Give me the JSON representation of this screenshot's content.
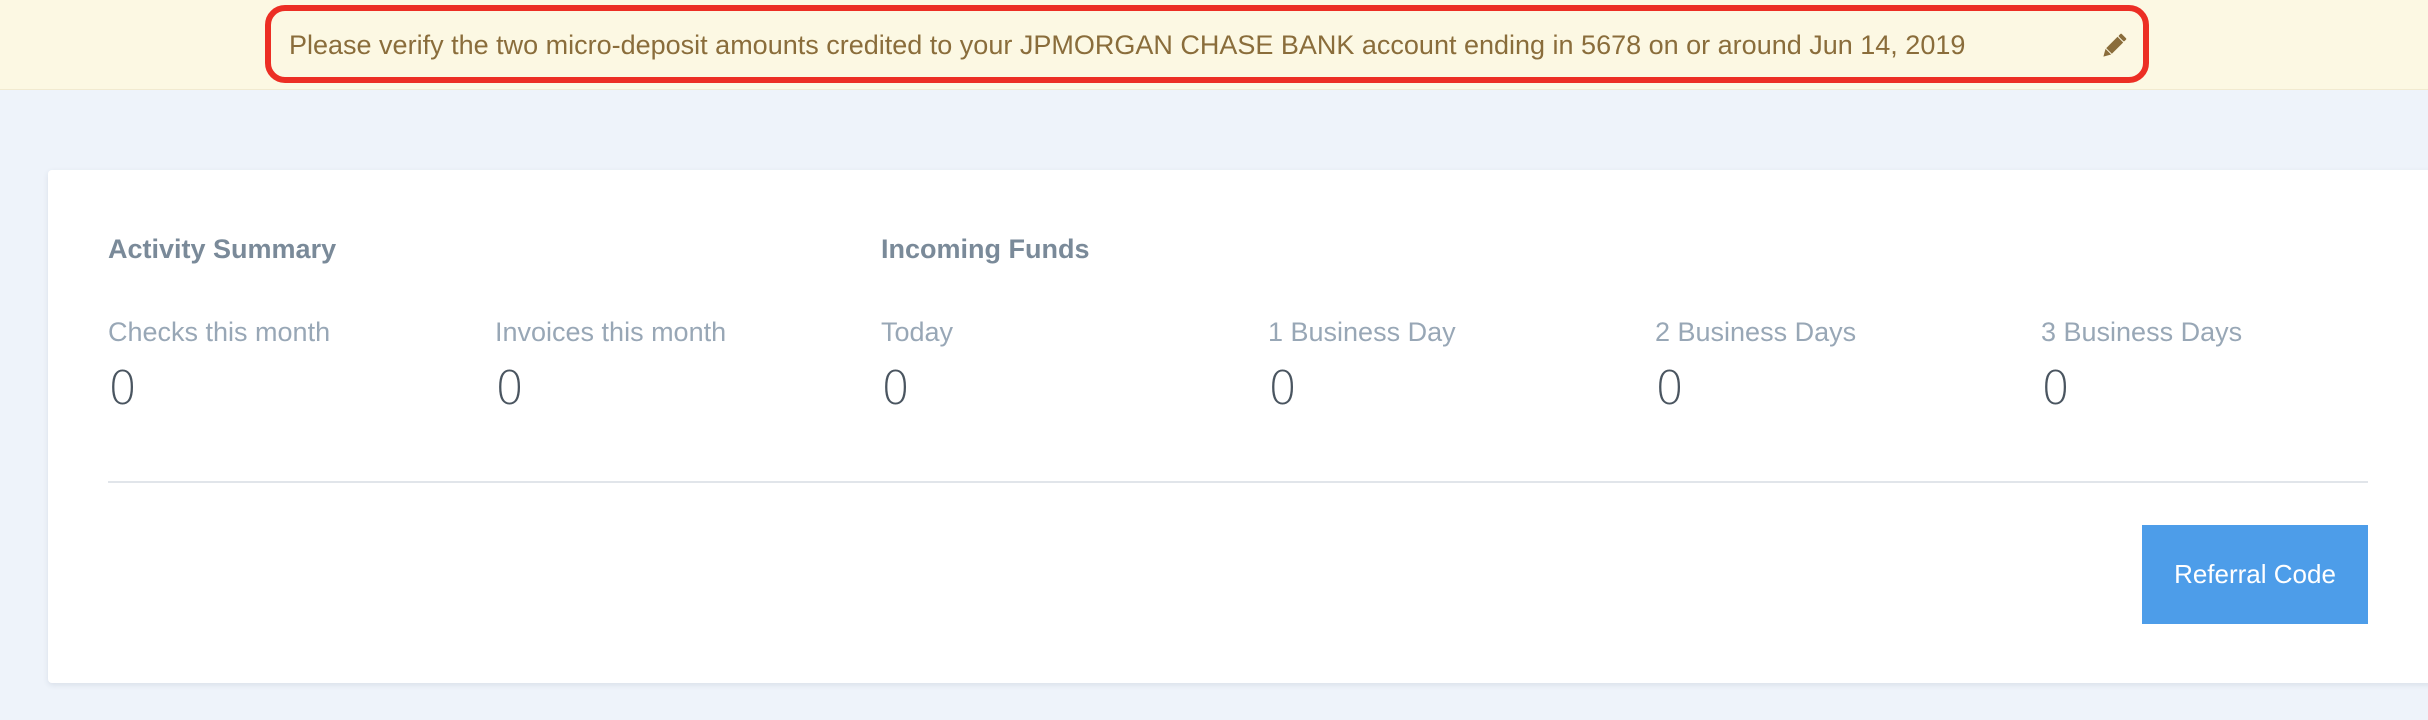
{
  "banner": {
    "message": "Please verify the two micro-deposit amounts credited to your JPMORGAN CHASE BANK account ending in 5678 on or around Jun 14, 2019",
    "edit_icon": "pencil-icon",
    "highlight_color": "#ec2e24"
  },
  "activity_summary": {
    "title": "Activity Summary",
    "stats": [
      {
        "label": "Checks this month",
        "value": "0"
      },
      {
        "label": "Invoices this month",
        "value": "0"
      }
    ]
  },
  "incoming_funds": {
    "title": "Incoming Funds",
    "stats": [
      {
        "label": "Today",
        "value": "0"
      },
      {
        "label": "1 Business Day",
        "value": "0"
      },
      {
        "label": "2 Business Days",
        "value": "0"
      },
      {
        "label": "3 Business Days",
        "value": "0"
      }
    ]
  },
  "actions": {
    "referral_label": "Referral Code"
  },
  "colors": {
    "banner_bg": "#fcf8e3",
    "banner_text": "#8a6d3b",
    "page_bg": "#eef3fa",
    "button_bg": "#4d9de9"
  }
}
